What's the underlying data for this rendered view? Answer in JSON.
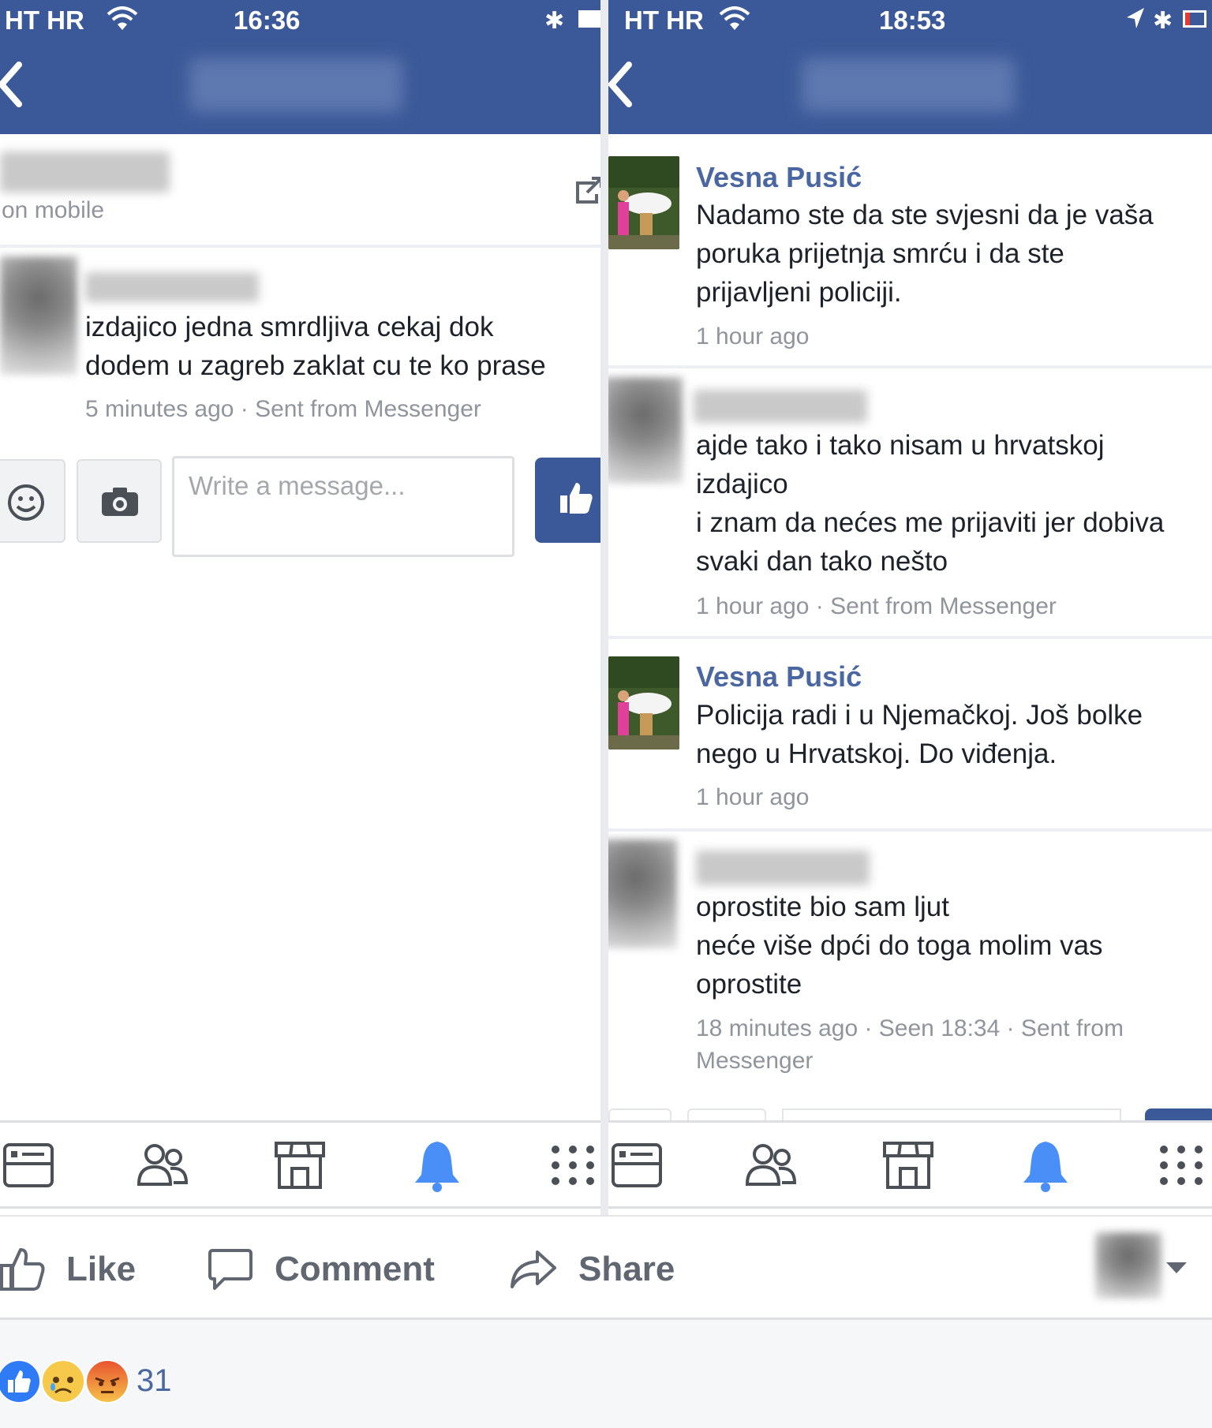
{
  "left": {
    "status": {
      "carrier": "HT HR",
      "time": "16:36"
    },
    "header": {
      "subtitle": "on mobile"
    },
    "message": {
      "text": "izdajico jedna smrdljiva cekaj dok\ndodem u zagreb zaklat cu te ko prase",
      "meta": "5 minutes ago · Sent from Messenger"
    },
    "composer": {
      "placeholder": "Write a message..."
    }
  },
  "right": {
    "status": {
      "carrier": "HT HR",
      "time": "18:53"
    },
    "messages": [
      {
        "sender": "Vesna Pusić",
        "text": "Nadamo ste da ste svjesni da je vaša\nporuka prijetnja smrću i da ste\nprijavljeni policiji.",
        "meta": "1 hour ago"
      },
      {
        "sender": "",
        "text": "ajde tako i tako nisam u hrvatskoj\nizdajico\ni znam da nećes me prijaviti jer dobiva\nsvaki dan tako nešto",
        "meta": "1 hour ago · Sent from Messenger"
      },
      {
        "sender": "Vesna Pusić",
        "text": "Policija radi i u Njemačkoj. Još bolke\nnego u Hrvatskoj. Do viđenja.",
        "meta": "1 hour ago"
      },
      {
        "sender": "",
        "text": "oprostite bio sam ljut\nneće više dpći do toga molim vas\noprostite",
        "meta": "18 minutes ago · Seen 18:34 · Sent from\nMessenger"
      }
    ]
  },
  "tabs": [
    "news-feed",
    "friends",
    "marketplace",
    "notifications",
    "menu"
  ],
  "actions": {
    "like": "Like",
    "comment": "Comment",
    "share": "Share"
  },
  "reactions": {
    "count": "31",
    "types": [
      "like",
      "sad",
      "angry"
    ]
  },
  "colors": {
    "brand": "#3b5998",
    "active_tab": "#4a8ff7",
    "name_link": "#4b67a1",
    "meta": "#90949c"
  }
}
